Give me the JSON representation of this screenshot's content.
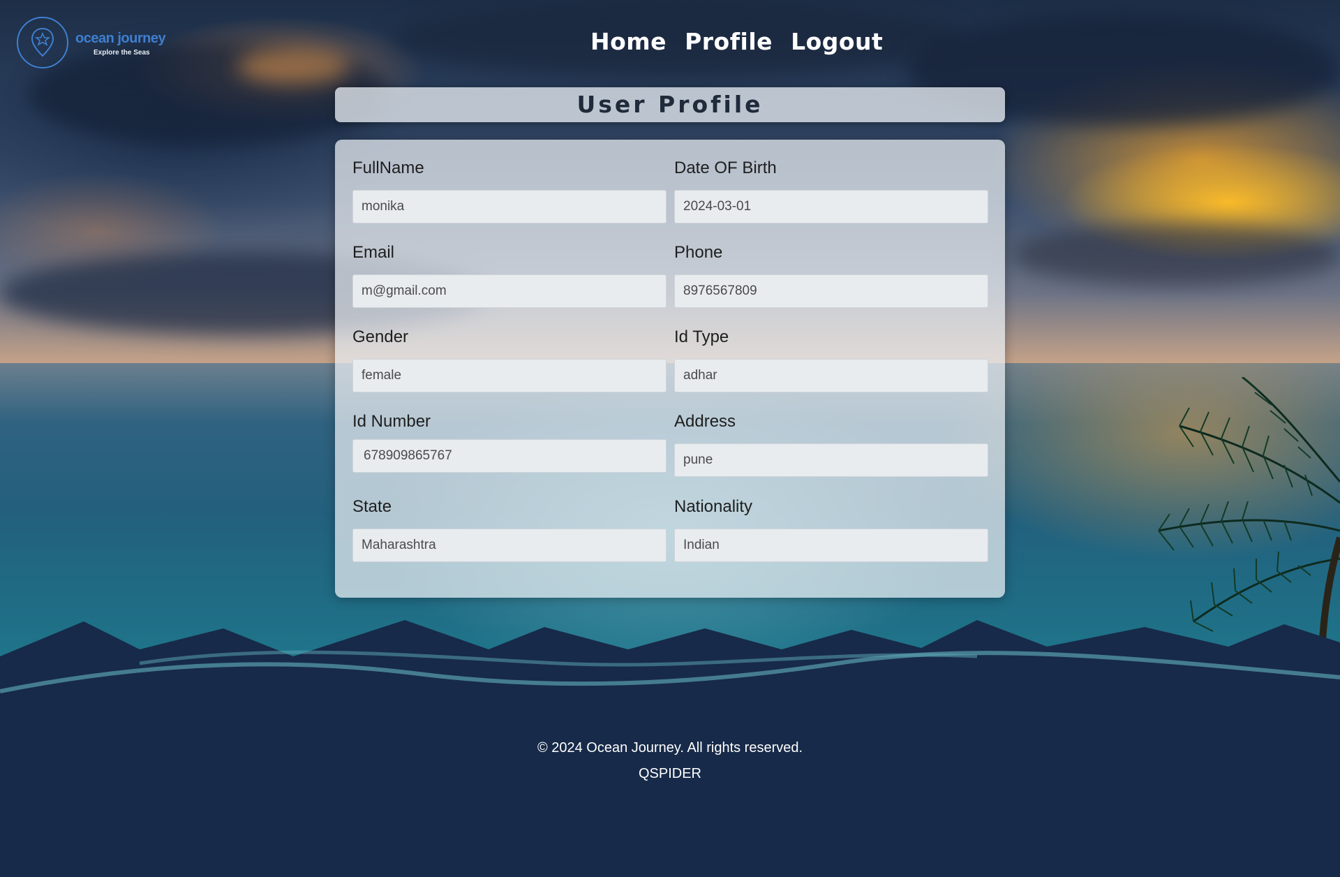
{
  "logo": {
    "title": "ocean journey",
    "subtitle": "Explore the Seas"
  },
  "nav": {
    "home": "Home",
    "profile": "Profile",
    "logout": "Logout"
  },
  "page": {
    "title": "User Profile"
  },
  "fields": {
    "fullname": {
      "label": "FullName",
      "value": "monika"
    },
    "dob": {
      "label": "Date OF Birth",
      "value": "2024-03-01"
    },
    "email": {
      "label": "Email",
      "value": "m@gmail.com"
    },
    "phone": {
      "label": "Phone",
      "value": "8976567809"
    },
    "gender": {
      "label": "Gender",
      "value": "female"
    },
    "id_type": {
      "label": "Id Type",
      "value": "adhar"
    },
    "id_number": {
      "label": "Id Number",
      "value": "678909865767"
    },
    "address": {
      "label": "Address",
      "value": "pune"
    },
    "state": {
      "label": "State",
      "value": "Maharashtra"
    },
    "nationality": {
      "label": "Nationality",
      "value": "Indian"
    }
  },
  "footer": {
    "copyright": "© 2024 Ocean Journey. All rights reserved.",
    "company": "QSPIDER"
  },
  "colors": {
    "footer_bg": "#172a49",
    "logo_blue": "#3f7fcf"
  },
  "icons": {
    "logo": "location-pin-star-icon"
  }
}
